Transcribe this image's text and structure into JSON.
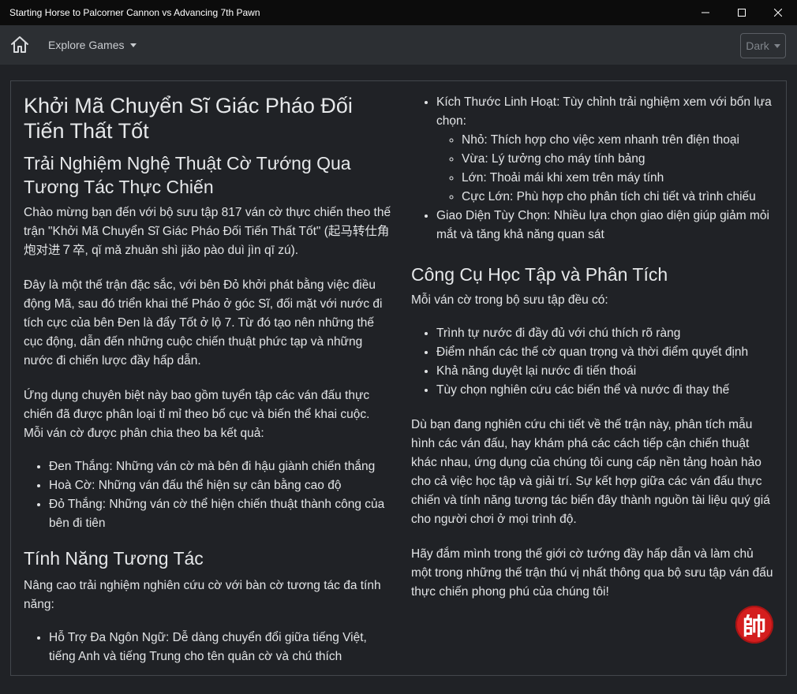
{
  "window": {
    "title": "Starting Horse to Palcorner Cannon vs Advancing 7th Pawn"
  },
  "nav": {
    "explore_label": "Explore Games",
    "theme_label": "Dark"
  },
  "content": {
    "title": "Khởi Mã Chuyển Sĩ Giác Pháo Đối Tiến Thất Tốt",
    "subtitle": "Trải Nghiệm Nghệ Thuật Cờ Tướng Qua Tương Tác Thực Chiến",
    "intro_p1": "Chào mừng bạn đến với bộ sưu tập 817 ván cờ thực chiến theo thế trận \"Khởi Mã Chuyển Sĩ Giác Pháo Đối Tiến Thất Tốt\" (起马转仕角炮对进７卒, qǐ mǎ zhuǎn shì jiǎo pào duì jìn qī zú).",
    "intro_p2": "Đây là một thế trận đặc sắc, với bên Đỏ khởi phát bằng việc điều động Mã, sau đó triển khai thế Pháo ở góc Sĩ, đối mặt với nước đi tích cực của bên Đen là đẩy Tốt ở lộ 7. Từ đó tạo nên những thế cục động, dẫn đến những cuộc chiến thuật phức tạp và những nước đi chiến lược đầy hấp dẫn.",
    "intro_p3": "Ứng dụng chuyên biệt này bao gồm tuyển tập các ván đấu thực chiến đã được phân loại tỉ mỉ theo bố cục và biến thể khai cuộc. Mỗi ván cờ được phân chia theo ba kết quả:",
    "results": [
      "Đen Thắng: Những ván cờ mà bên đi hậu giành chiến thắng",
      "Hoà Cờ: Những ván đấu thể hiện sự cân bằng cao độ",
      "Đỏ Thắng: Những ván cờ thể hiện chiến thuật thành công của bên đi tiên"
    ],
    "features_heading": "Tính Năng Tương Tác",
    "features_intro": "Nâng cao trải nghiệm nghiên cứu cờ với bàn cờ tương tác đa tính năng:",
    "feature_lang": "Hỗ Trợ Đa Ngôn Ngữ: Dễ dàng chuyển đổi giữa tiếng Việt, tiếng Anh và tiếng Trung cho tên quân cờ và chú thích",
    "feature_size": "Kích Thước Linh Hoạt: Tùy chỉnh trải nghiệm xem với bốn lựa chọn:",
    "sizes": [
      "Nhỏ: Thích hợp cho việc xem nhanh trên điện thoại",
      "Vừa: Lý tưởng cho máy tính bảng",
      "Lớn: Thoải mái khi xem trên máy tính",
      "Cực Lớn: Phù hợp cho phân tích chi tiết và trình chiếu"
    ],
    "feature_theme": "Giao Diện Tùy Chọn: Nhiều lựa chọn giao diện giúp giảm mỏi mắt và tăng khả năng quan sát",
    "tools_heading": "Công Cụ Học Tập và Phân Tích",
    "tools_intro": "Mỗi ván cờ trong bộ sưu tập đều có:",
    "tools": [
      "Trình tự nước đi đầy đủ với chú thích rõ ràng",
      "Điểm nhấn các thế cờ quan trọng và thời điểm quyết định",
      "Khả năng duyệt lại nước đi tiến thoái",
      "Tùy chọn nghiên cứu các biến thể và nước đi thay thế"
    ],
    "outro_p1": "Dù bạn đang nghiên cứu chi tiết về thế trận này, phân tích mẫu hình các ván đấu, hay khám phá các cách tiếp cận chiến thuật khác nhau, ứng dụng của chúng tôi cung cấp nền tảng hoàn hảo cho cả việc học tập và giải trí. Sự kết hợp giữa các ván đấu thực chiến và tính năng tương tác biến đây thành nguồn tài liệu quý giá cho người chơi ở mọi trình độ.",
    "outro_p2": "Hãy đắm mình trong thế giới cờ tướng đầy hấp dẫn và làm chủ một trong những thế trận thú vị nhất thông qua bộ sưu tập ván đấu thực chiến phong phú của chúng tôi!"
  },
  "logo_char": "帥",
  "colors": {
    "titlebar": "#0c0c0c",
    "navbar": "#2c2f33",
    "background": "#202226",
    "logo": "#d41e1e"
  },
  "icons": [
    "minimize-icon",
    "maximize-icon",
    "close-icon",
    "home-icon",
    "caret-down-icon"
  ]
}
